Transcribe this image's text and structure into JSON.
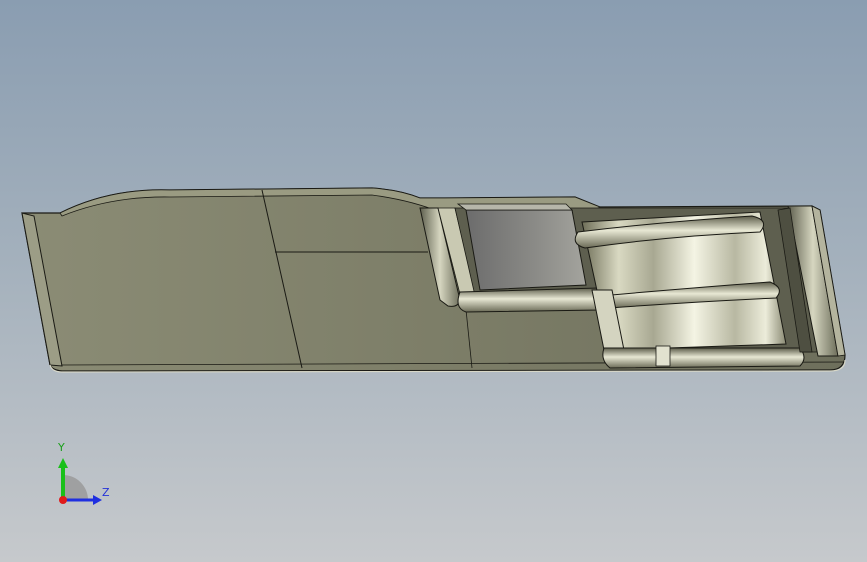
{
  "viewport": {
    "background_top": "#8a9db1",
    "background_bottom": "#c6c9cc"
  },
  "model": {
    "part_color": "#7f806b",
    "edge_color": "#1a1a14",
    "spring_highlight": "#f2f2e0"
  },
  "triad": {
    "y_label": "Y",
    "z_label": "Z",
    "y_color": "#19c019",
    "z_color": "#1f2fe0",
    "x_color": "#e01b1b"
  }
}
